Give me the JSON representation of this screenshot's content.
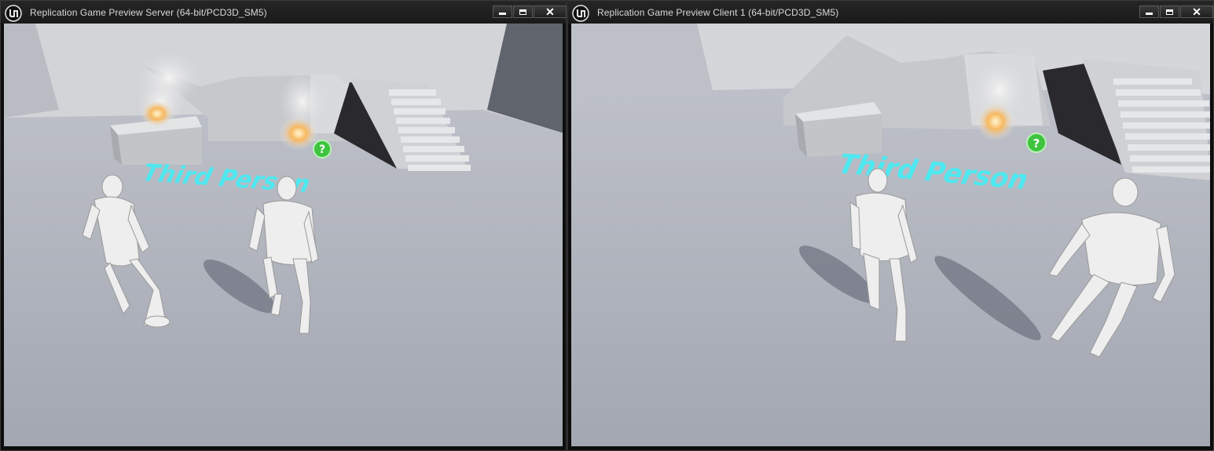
{
  "windows": [
    {
      "title": "Replication Game Preview Server (64-bit/PCD3D_SM5)",
      "controls": {
        "minimize": "minimize",
        "maximize": "maximize",
        "close": "✕"
      },
      "viewport": {
        "floor_text": "Third Person",
        "characters": 2,
        "fires": 2
      }
    },
    {
      "title": "Replication Game Preview Client 1 (64-bit/PCD3D_SM5)",
      "controls": {
        "minimize": "minimize",
        "maximize": "maximize",
        "close": "✕"
      },
      "viewport": {
        "floor_text": "Third Person",
        "characters": 2,
        "fires": 1
      }
    }
  ],
  "colors": {
    "titlebar": "#1f1f1f",
    "floor": "#a9adb7",
    "floor_text": "#4fe8f0",
    "walls": "#c9ccd1",
    "help_icon": "#3ec43e"
  },
  "icons": {
    "app_logo": "unreal-engine-logo-icon",
    "help": "question-mark-icon"
  }
}
